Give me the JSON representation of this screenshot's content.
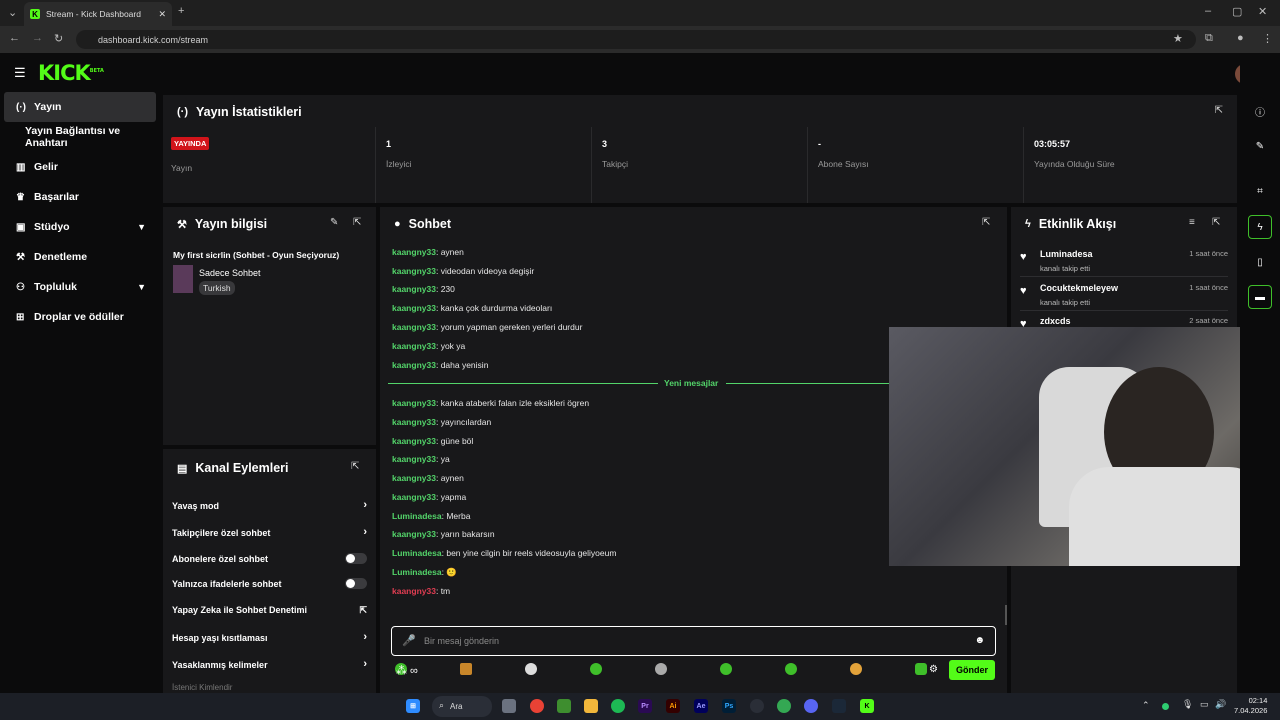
{
  "browser": {
    "tab_title": "Stream - Kick Dashboard",
    "url": "dashboard.kick.com/stream"
  },
  "logo": {
    "text": "KICK",
    "tag": "BETA"
  },
  "sidebar": {
    "items": [
      {
        "label": "Yayın",
        "icon": "broadcast-icon"
      },
      {
        "label": "Yayın Bağlantısı ve Anahtarı",
        "icon": ""
      },
      {
        "label": "Gelir",
        "icon": "chart-icon"
      },
      {
        "label": "Başarılar",
        "icon": "trophy-icon"
      },
      {
        "label": "Stüdyo",
        "icon": "studio-icon"
      },
      {
        "label": "Denetleme",
        "icon": "wrench-icon"
      },
      {
        "label": "Topluluk",
        "icon": "community-icon"
      },
      {
        "label": "Droplar ve ödüller",
        "icon": "gift-icon"
      }
    ]
  },
  "stats": {
    "title": "Yayın İstatistikleri",
    "live_badge": "YAYINDA",
    "items": [
      {
        "value": "",
        "label": "Yayın"
      },
      {
        "value": "1",
        "label": "İzleyici"
      },
      {
        "value": "3",
        "label": "Takipçi"
      },
      {
        "value": "-",
        "label": "Abone Sayısı"
      },
      {
        "value": "03:05:57",
        "label": "Yayında Olduğu Süre"
      }
    ]
  },
  "stream_info": {
    "title": "Yayın bilgisi",
    "stream_title": "My first sicrlin (Sohbet - Oyun Seçiyoruz)",
    "category": "Sadece Sohbet",
    "language": "Turkish"
  },
  "channel_actions": {
    "title": "Kanal Eylemleri",
    "items": [
      {
        "label": "Yavaş mod",
        "control": "arrow"
      },
      {
        "label": "Takipçilere özel sohbet",
        "control": "arrow"
      },
      {
        "label": "Abonelere özel sohbet",
        "control": "toggle"
      },
      {
        "label": "Yalnızca ifadelerle sohbet",
        "control": "toggle"
      },
      {
        "label": "Yapay Zeka ile Sohbet Denetimi",
        "control": "external"
      },
      {
        "label": "Hesap yaşı kısıtlaması",
        "control": "arrow"
      },
      {
        "label": "Yasaklanmış kelimeler",
        "control": "arrow"
      },
      {
        "label": "İstenici Kimlendir",
        "control": ""
      }
    ]
  },
  "chat": {
    "title": "Sohbet",
    "new_messages_label": "Yeni mesajlar",
    "messages_before": [
      {
        "user": "kaangny33",
        "text": "aynen"
      },
      {
        "user": "kaangny33",
        "text": "videodan videoya degişir"
      },
      {
        "user": "kaangny33",
        "text": "230"
      },
      {
        "user": "kaangny33",
        "text": "kanka çok durdurma videoları"
      },
      {
        "user": "kaangny33",
        "text": "yorum yapman gereken yerleri durdur"
      },
      {
        "user": "kaangny33",
        "text": "yok ya"
      },
      {
        "user": "kaangny33",
        "text": "daha yenisin"
      }
    ],
    "messages_after": [
      {
        "user": "kaangny33",
        "text": "kanka ataberki falan izle eksikleri ögren"
      },
      {
        "user": "kaangny33",
        "text": "yayıncılardan"
      },
      {
        "user": "kaangny33",
        "text": "güne böl"
      },
      {
        "user": "kaangny33",
        "text": "ya"
      },
      {
        "user": "kaangny33",
        "text": "aynen"
      },
      {
        "user": "kaangny33",
        "text": "yapma"
      },
      {
        "user": "Luminadesa",
        "text": "Merba"
      },
      {
        "user": "kaangny33",
        "text": "yarın bakarsın"
      },
      {
        "user": "Luminadesa",
        "text": "ben yine cilgin bir reels videosuyla geliyoeum"
      },
      {
        "user": "Luminadesa",
        "text": "🙂"
      },
      {
        "user": "kaangny33",
        "text": "tm"
      }
    ],
    "input_placeholder": "Bir mesaj gönderin",
    "send_label": "Gönder"
  },
  "activity": {
    "title": "Etkinlik Akışı",
    "items": [
      {
        "name": "Luminadesa",
        "desc": "kanalı takip etti",
        "time": "1 saat önce"
      },
      {
        "name": "Cocuktekmeleyew",
        "desc": "kanalı takip etti",
        "time": "1 saat önce"
      },
      {
        "name": "zdxcds",
        "desc": "",
        "time": "2 saat önce"
      }
    ]
  },
  "taskbar": {
    "search_label": "Ara",
    "time": "02:14",
    "date": "7.04.2026"
  },
  "colors": {
    "accent": "#53fc18",
    "live": "#d1141a",
    "user": "#53d46a"
  }
}
